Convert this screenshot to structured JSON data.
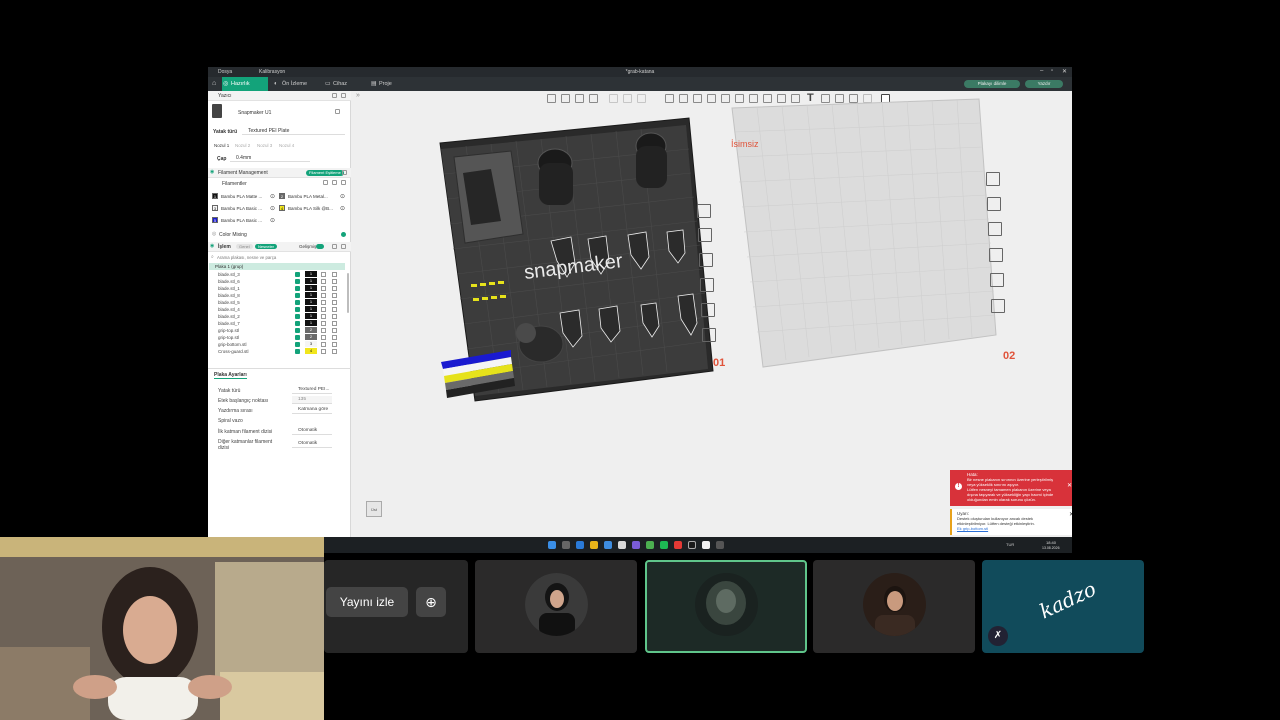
{
  "window": {
    "title": "*grab-katana",
    "left_menu": "Dosya",
    "menu_extra": "Kalibrasyon",
    "tabs": [
      {
        "label": "Hazırlık",
        "active": true
      },
      {
        "label": "Ön İzleme",
        "active": false
      },
      {
        "label": "Cihaz",
        "active": false
      },
      {
        "label": "Proje",
        "active": false
      }
    ],
    "right_buttons": [
      "Plakayı dilimle",
      "Yazdır"
    ]
  },
  "printer": {
    "section_label": "Yazıcı",
    "name": "Snapmaker U1",
    "bed_type_label": "Yatak türü",
    "bed_type_value": "Textured PEI Plate",
    "nozzle_tabs": [
      "Nozul 1",
      "Nozul 2",
      "Nozul 3",
      "Nozul 4"
    ],
    "diameter_label": "Çap",
    "diameter_value": "0.4mm"
  },
  "filament": {
    "management_label": "Filament Management",
    "management_button": "Filament Eşitleme",
    "list_label": "Filamentler",
    "items": [
      {
        "index": "1",
        "name": "Bambu PLA Matte ...",
        "color": "#111111"
      },
      {
        "index": "2",
        "name": "Bambu PLA Metal...",
        "color": "#6a6a6a"
      },
      {
        "index": "3",
        "name": "Bambu PLA Basic ...",
        "color": "#f5f5f5"
      },
      {
        "index": "4",
        "name": "Bambu PLA Silk @B...",
        "color": "#f1e61c"
      },
      {
        "index": "5",
        "name": "Bambu PLA Basic ...",
        "color": "#1a1ad0"
      }
    ],
    "color_mixing_label": "Color Mixing"
  },
  "process": {
    "label": "İşlem",
    "toggle_a": "Genel",
    "toggle_b": "Nesneler",
    "advanced_label": "Gelişmiş",
    "search_placeholder": "Arama plakası, nesne ve parça",
    "plate_label": "Plaka 1 (grup)",
    "objects": [
      {
        "name": "blade.stl_3",
        "num": "1"
      },
      {
        "name": "blade.stl_6",
        "num": "1"
      },
      {
        "name": "blade.stl_1",
        "num": "1"
      },
      {
        "name": "blade.stl_8",
        "num": "1"
      },
      {
        "name": "blade.stl_5",
        "num": "1"
      },
      {
        "name": "blade.stl_4",
        "num": "1"
      },
      {
        "name": "blade.stl_2",
        "num": "1"
      },
      {
        "name": "blade.stl_7",
        "num": "1"
      },
      {
        "name": "grip-top.stl",
        "num": "2"
      },
      {
        "name": "grip-top.stl",
        "num": "2"
      },
      {
        "name": "grip-bottom.stl",
        "num": "3"
      },
      {
        "name": "Cross-guard.stl",
        "num": "4"
      }
    ]
  },
  "plate_settings": {
    "tab": "Plaka Ayarları",
    "rows": [
      {
        "label": "Yatak türü",
        "value": "Textured PEI..."
      },
      {
        "label": "Etek başlangıç noktası",
        "value": "135"
      },
      {
        "label": "Yazdırma sırası",
        "value": "Katmana göre"
      },
      {
        "label": "Spiral vazo",
        "value": ""
      },
      {
        "label": "İlk katman filament dizisi",
        "value": "Otomatik"
      },
      {
        "label": "Diğer katmanlar filament dizisi",
        "value": "Otomatik"
      }
    ]
  },
  "viewport": {
    "plate1_number": "01",
    "plate2_number": "02",
    "plate2_name": "İsimsiz",
    "brand_text": "snapmaker",
    "cube_label": "Üst"
  },
  "notifications": {
    "error_title": "Hata:",
    "error_lines": [
      "Bir nesne plakanın sınırının üzerine yerleştirilmiş",
      "veya yükseklik sınırını aşıyor.",
      "Lütfen nesneyi tamamen plakanın üzerine veya",
      "dışına taşıyarak ve yüksekliğin yapı hacmi içinde",
      "olduğundan emin olarak sorunu çözün."
    ],
    "warn_title": "Uyarı:",
    "warn_lines": [
      "Destek oluşturulan kullanıyor ancak destek",
      "etkinleştirilmiyor. Lütfen desteği etkinleştirin.",
      "Ek grip-bottom.stl"
    ]
  },
  "taskbar": {
    "time": "18:40",
    "date": "13.08.2026",
    "tray_text": "TUR"
  },
  "meeting": {
    "watch_label": "Yayını izle",
    "signature_text": "kadzo"
  },
  "colors": {
    "accent": "#13a37a",
    "error": "#d8323a",
    "plate_number": "#e0533a"
  }
}
